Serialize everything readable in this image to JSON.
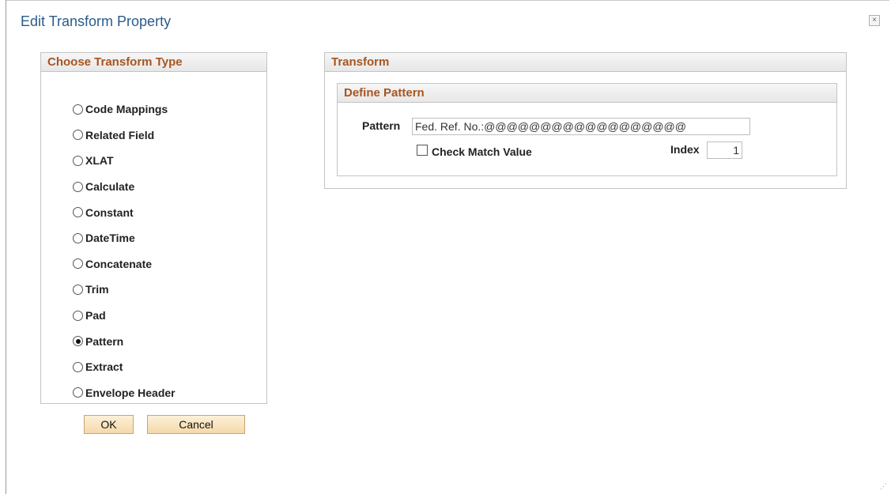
{
  "dialog": {
    "title": "Edit Transform Property",
    "close_label": "×"
  },
  "choose_type": {
    "header": "Choose Transform Type",
    "options": [
      {
        "label": "Code Mappings",
        "checked": false
      },
      {
        "label": "Related Field",
        "checked": false
      },
      {
        "label": "XLAT",
        "checked": false
      },
      {
        "label": "Calculate",
        "checked": false
      },
      {
        "label": "Constant",
        "checked": false
      },
      {
        "label": "DateTime",
        "checked": false
      },
      {
        "label": "Concatenate",
        "checked": false
      },
      {
        "label": "Trim",
        "checked": false
      },
      {
        "label": "Pad",
        "checked": false
      },
      {
        "label": "Pattern",
        "checked": true
      },
      {
        "label": "Extract",
        "checked": false
      },
      {
        "label": "Envelope Header",
        "checked": false
      }
    ]
  },
  "buttons": {
    "ok": "OK",
    "cancel": "Cancel"
  },
  "transform": {
    "header": "Transform",
    "define_pattern": {
      "header": "Define Pattern",
      "pattern_label": "Pattern",
      "pattern_value": "Fed. Ref. No.:@@@@@@@@@@@@@@@@@@",
      "check_match_label": "Check Match Value",
      "check_match_checked": false,
      "index_label": "Index",
      "index_value": "1"
    }
  },
  "icons": {
    "radio": "radio-button-icon",
    "checkbox": "checkbox-icon",
    "close": "close-icon",
    "resize": "resize-grip-icon"
  }
}
